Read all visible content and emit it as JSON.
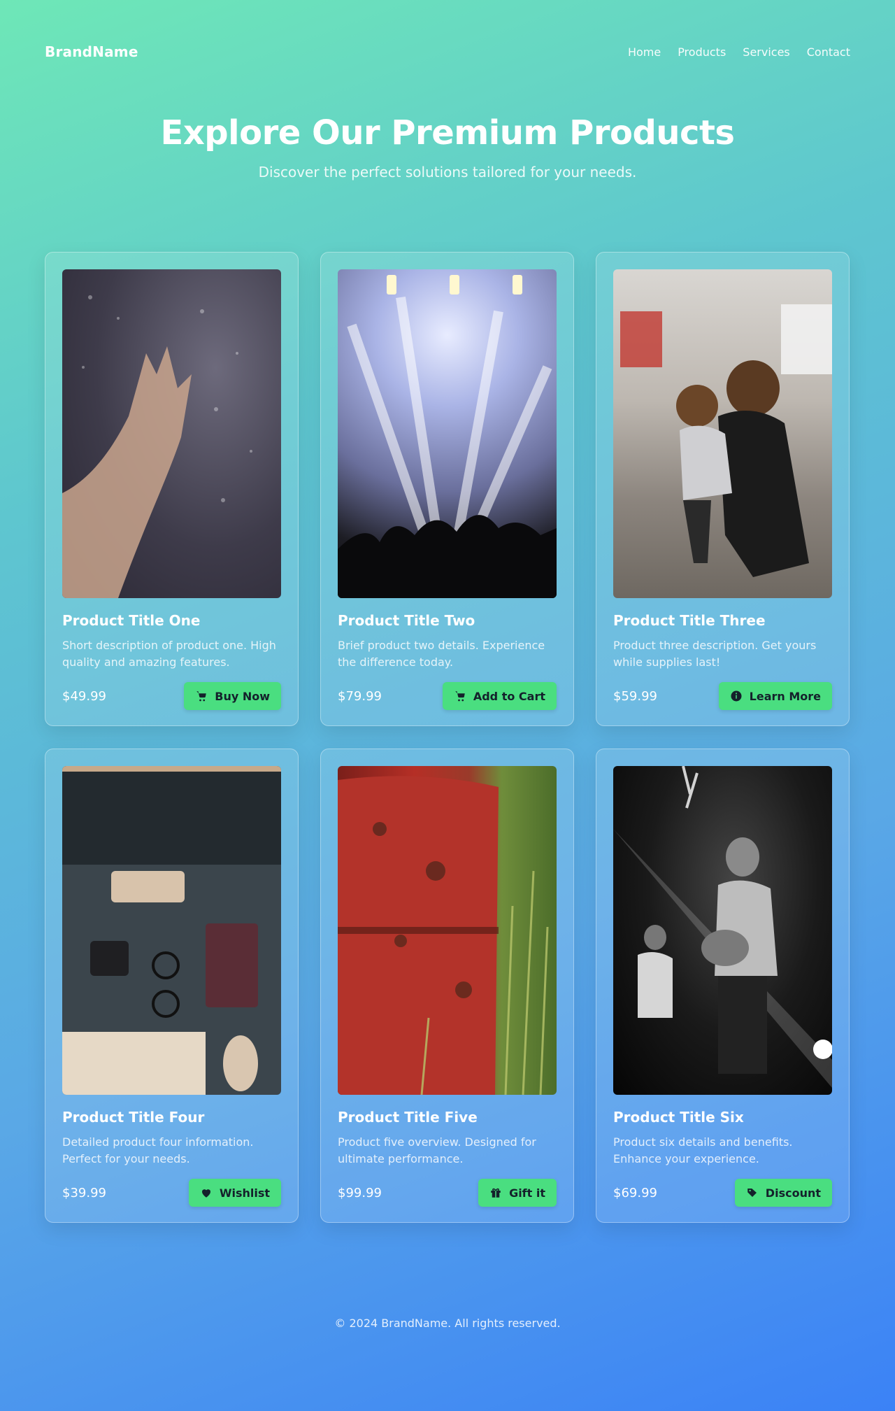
{
  "nav": {
    "brand": "BrandName",
    "links": [
      "Home",
      "Products",
      "Services",
      "Contact"
    ]
  },
  "hero": {
    "title": "Explore Our Premium Products",
    "subtitle": "Discover the perfect solutions tailored for your needs."
  },
  "products": [
    {
      "title": "Product Title One",
      "description": "Short description of product one. High quality and amazing features.",
      "price": "$49.99",
      "button": "Buy Now",
      "icon": "cart-icon",
      "image": "rain-window-hand"
    },
    {
      "title": "Product Title Two",
      "description": "Brief product two details. Experience the difference today.",
      "price": "$79.99",
      "button": "Add to Cart",
      "icon": "cart-icon",
      "image": "concert-lights"
    },
    {
      "title": "Product Title Three",
      "description": "Product three description. Get yours while supplies last!",
      "price": "$59.99",
      "button": "Learn More",
      "icon": "info-icon",
      "image": "mother-child-street"
    },
    {
      "title": "Product Title Four",
      "description": "Detailed product four information. Perfect for your needs.",
      "price": "$39.99",
      "button": "Wishlist",
      "icon": "heart-icon",
      "image": "desk-keyboard"
    },
    {
      "title": "Product Title Five",
      "description": "Product five overview. Designed for ultimate performance.",
      "price": "$99.99",
      "button": "Gift it",
      "icon": "gift-icon",
      "image": "rusty-barrel-grass"
    },
    {
      "title": "Product Title Six",
      "description": "Product six details and benefits. Enhance your experience.",
      "price": "$69.99",
      "button": "Discount",
      "icon": "tag-icon",
      "image": "guitarist-stage"
    }
  ],
  "footer": {
    "text": "© 2024 BrandName. All rights reserved."
  },
  "colors": {
    "button": "#4ade80",
    "button_text": "#14212b",
    "gradient_start": "#6ee7b7",
    "gradient_end": "#3b82f6"
  }
}
